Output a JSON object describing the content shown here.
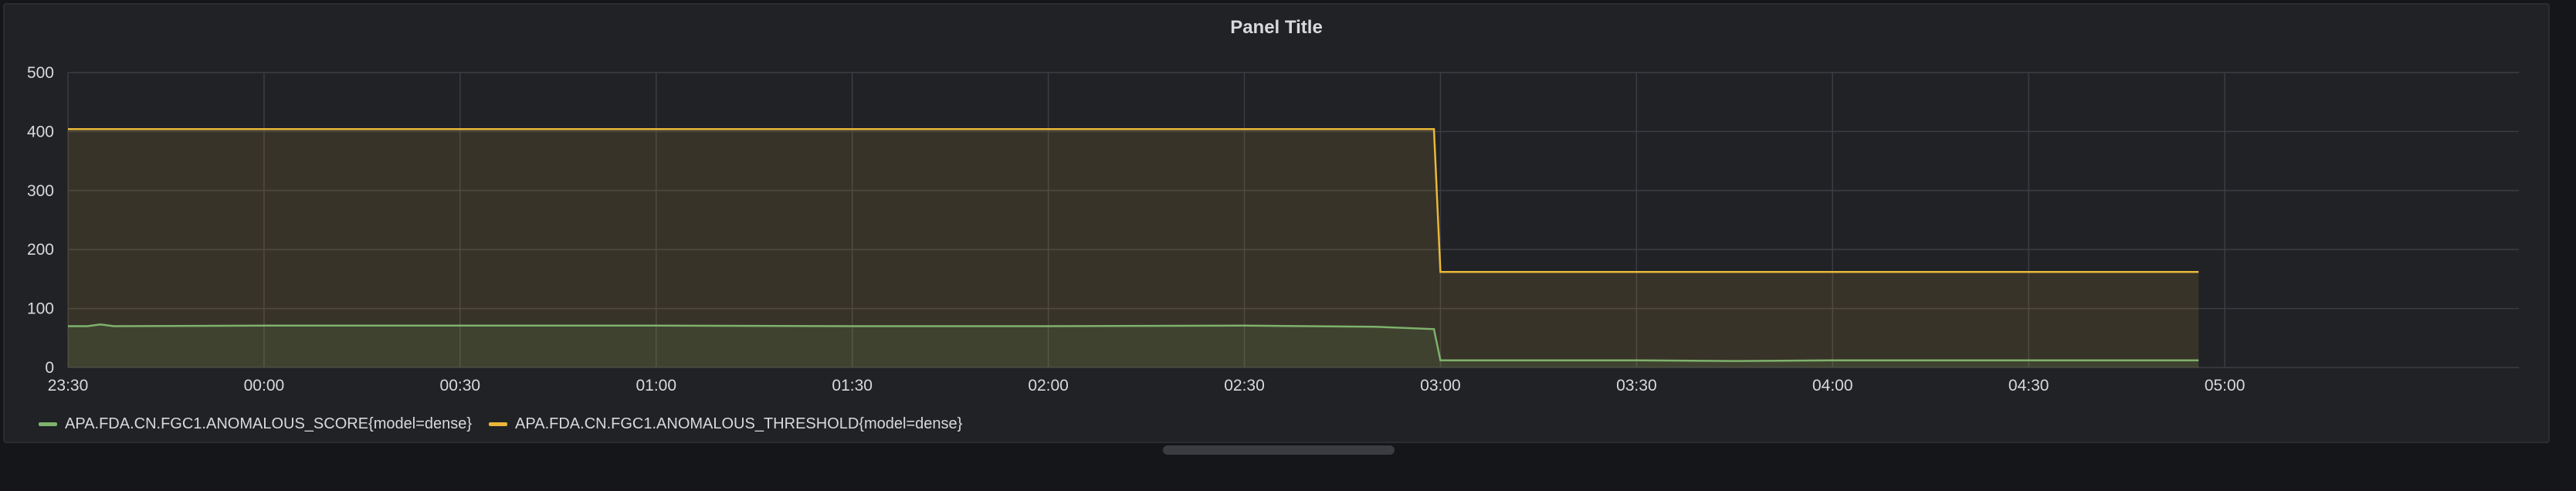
{
  "panel": {
    "title": "Panel Title"
  },
  "chart_data": {
    "type": "area",
    "title": "Panel Title",
    "xlabel": "",
    "ylabel": "",
    "x_time_range": [
      "23:30",
      "05:45"
    ],
    "ylim": [
      0,
      500
    ],
    "yticks": [
      0,
      100,
      200,
      300,
      400,
      500
    ],
    "xticks": [
      "23:30",
      "00:00",
      "00:30",
      "01:00",
      "01:30",
      "02:00",
      "02:30",
      "03:00",
      "03:30",
      "04:00",
      "04:30",
      "05:00"
    ],
    "grid": true,
    "legend_position": "bottom-left",
    "series": [
      {
        "name": "APA.FDA.CN.FGC1.ANOMALOUS_SCORE{model=dense}",
        "color": "#7eb26d",
        "points": [
          [
            "23:30",
            70
          ],
          [
            "23:33",
            70
          ],
          [
            "23:35",
            73
          ],
          [
            "23:37",
            70
          ],
          [
            "00:00",
            71
          ],
          [
            "00:30",
            71
          ],
          [
            "01:00",
            71
          ],
          [
            "01:30",
            70
          ],
          [
            "02:00",
            70
          ],
          [
            "02:30",
            71
          ],
          [
            "02:50",
            69
          ],
          [
            "02:59",
            65
          ],
          [
            "03:00",
            12
          ],
          [
            "03:30",
            12
          ],
          [
            "03:45",
            11
          ],
          [
            "04:00",
            12
          ],
          [
            "04:30",
            12
          ],
          [
            "04:56",
            12
          ]
        ]
      },
      {
        "name": "APA.FDA.CN.FGC1.ANOMALOUS_THRESHOLD{model=dense}",
        "color": "#eab839",
        "points": [
          [
            "23:30",
            404
          ],
          [
            "02:59",
            404
          ],
          [
            "03:00",
            162
          ],
          [
            "04:56",
            162
          ]
        ]
      }
    ]
  }
}
